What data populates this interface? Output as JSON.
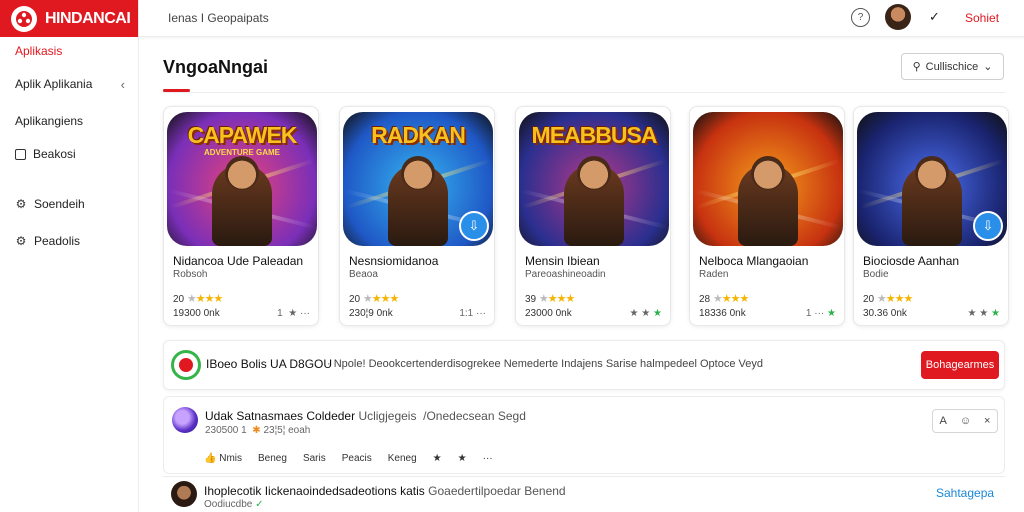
{
  "brand": {
    "name": "HINDANCAI"
  },
  "sidebar": {
    "section_label": "Aplikasis",
    "items": [
      {
        "label": "Aplik Aplikania",
        "icon": "chevron-left-icon"
      },
      {
        "label": "Aplikangiens",
        "icon": ""
      },
      {
        "label": "Beakosi",
        "icon": "checkbox-icon"
      },
      {
        "label": "Soendeih",
        "icon": "gear-icon"
      },
      {
        "label": "Peadolis",
        "icon": "gear-icon"
      }
    ]
  },
  "topbar": {
    "breadcrumb": "Ienas I Geopaipats",
    "signout_label": "Sohiet"
  },
  "main": {
    "title": "VngoaNngai",
    "collections_label": "Cullischice"
  },
  "apps": [
    {
      "art_word": "CAPAWEK",
      "art_sub": "ADVENTURE GAME",
      "name": "Nidancoa Ude Paleadan",
      "sub": "Robsoh",
      "rating": "20",
      "count": "19300 0nk",
      "actions": "1  ★ ···",
      "colors": [
        "#7a2fb8",
        "#e8437a"
      ]
    },
    {
      "art_word": "RADKAN",
      "art_sub": "",
      "name": "Nesnsiomidanoa",
      "sub": "Beaoa",
      "rating": "20",
      "count": "230¦9 0nk",
      "actions": "1:1 ···",
      "colors": [
        "#1f58c6",
        "#35b4f0"
      ]
    },
    {
      "art_word": "MEABBUSA",
      "art_sub": "",
      "name": "Mensin Ibiean",
      "sub": "Pareoashineoadin",
      "rating": "39",
      "count": "23000 0nk",
      "actions": "★ ★",
      "colors": [
        "#2a2f8f",
        "#b5398a"
      ]
    },
    {
      "art_word": "",
      "art_sub": "",
      "name": "Nelboca Mlangaoian",
      "sub": "Raden",
      "rating": "28",
      "count": "18336 0nk",
      "actions": "1 ···",
      "colors": [
        "#c73210",
        "#f59d1b"
      ]
    },
    {
      "art_word": "",
      "art_sub": "",
      "name": "Biociosde Aanhan",
      "sub": "Bodie",
      "rating": "20",
      "count": "30.36 0nk",
      "actions": "★ ★",
      "colors": [
        "#1a2470",
        "#4c6ff0"
      ]
    }
  ],
  "banner": {
    "title": "IBoeo Bolis UA D8GOU",
    "text": "· Npole! Deookcertenderdisogrekee Nemederte Indajens Sarise halmpedeel Optoce Veyd",
    "button_label": "Bohagearmes"
  },
  "post": {
    "title": "Udak Satnasmaes Coldeder",
    "title_rest": "Ucligjegeis  /Onedecsean Segd",
    "meta": "230500 1 ",
    "meta_rest": "23¦5¦ eoah",
    "actions": [
      "Nmis",
      "Beneg",
      "Saris",
      "Peacis",
      "Keneg"
    ]
  },
  "comment": {
    "title": "Ihoplecotik Iickenaoindedsadeotions katis",
    "title_rest": "Goaedertilpoedar Benend",
    "meta": "Oodiucdbe",
    "link_label": "Sahtagepa"
  }
}
